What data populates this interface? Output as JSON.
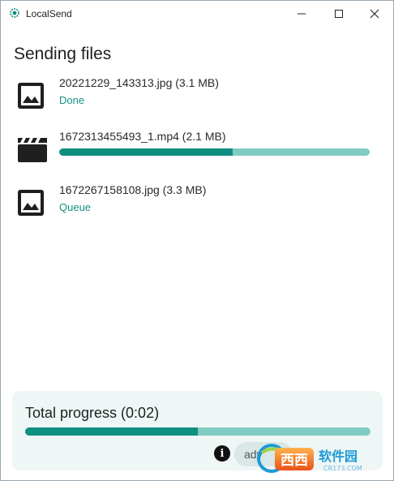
{
  "window": {
    "title": "LocalSend",
    "controls": {
      "minimize_icon": "minimize-icon",
      "maximize_icon": "maximize-icon",
      "close_icon": "close-icon"
    }
  },
  "heading": "Sending files",
  "files": [
    {
      "name": "20221229_143313.jpg (3.1 MB)",
      "icon": "image-icon",
      "status": "Done",
      "progress": null
    },
    {
      "name": "1672313455493_1.mp4 (2.1 MB)",
      "icon": "video-clapper-icon",
      "status": null,
      "progress": 0.56
    },
    {
      "name": "1672267158108.jpg (3.3 MB)",
      "icon": "image-icon",
      "status": "Queue",
      "progress": null
    }
  ],
  "total": {
    "label": "Total progress (0:02)",
    "progress": 0.5
  },
  "footer": {
    "info_label": "i",
    "advanced_label": "adv"
  },
  "colors": {
    "accent": "#0f8f80",
    "track": "#82cbc2",
    "panel": "#eef6f6"
  },
  "watermark": {
    "brand": "西西软件园",
    "url": "CR173.COM"
  }
}
